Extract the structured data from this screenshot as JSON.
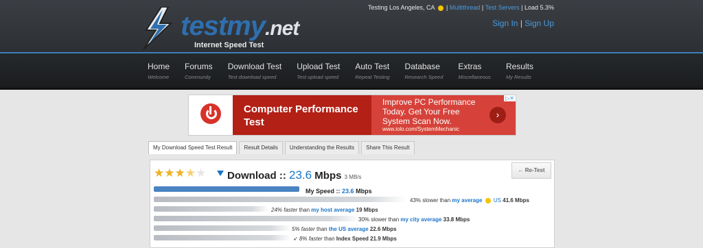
{
  "header": {
    "logo_main": "testmy",
    "logo_net": ".net",
    "logo_sub": "Internet Speed Test",
    "status_prefix": "Testing Los Angeles, CA",
    "status_multithread": "Multithread",
    "status_test_servers": "Test Servers",
    "status_load": "Load 5.3%",
    "sign_in": "Sign In",
    "sign_up": "Sign Up"
  },
  "nav": [
    {
      "title": "Home",
      "sub": "Welcome"
    },
    {
      "title": "Forums",
      "sub": "Community"
    },
    {
      "title": "Download Test",
      "sub": "Test download speed"
    },
    {
      "title": "Upload Test",
      "sub": "Test upload speed"
    },
    {
      "title": "Auto Test",
      "sub": "Repeat Testing"
    },
    {
      "title": "Database",
      "sub": "Research Speed"
    },
    {
      "title": "Extras",
      "sub": "Miscellaneous"
    },
    {
      "title": "Results",
      "sub": "My Results"
    }
  ],
  "ad": {
    "headline": "Computer Performance Test",
    "body": "Improve PC Performance Today. Get Your Free System Scan Now.",
    "url": "www.iolo.com/SystemMechanic",
    "go_label": "›",
    "ad_badge": "▷✕"
  },
  "tabs": [
    {
      "label": "My Download Speed Test Result",
      "active": true
    },
    {
      "label": "Result Details",
      "active": false
    },
    {
      "label": "Understanding the Results",
      "active": false
    },
    {
      "label": "Share This Result",
      "active": false
    }
  ],
  "result": {
    "rating_stars": 3.5,
    "download_label": "Download",
    "separator": "::",
    "speed": "23.6",
    "speed_unit": "Mbps",
    "speed_mbs": "3 MB/s",
    "retest": "← Re-Test",
    "my_speed_label": "My Speed ::",
    "my_speed_value": "23.6",
    "my_speed_unit": "Mbps"
  },
  "comparisons": [
    {
      "prefix": "43% slower than",
      "link": "my average",
      "mid": "US",
      "suffix": "41.6 Mbps",
      "fill": 0.63
    },
    {
      "prefix_italic": "24% faster",
      "prefix": "than",
      "link": "my host average",
      "suffix": "19 Mbps",
      "fill": 0.26
    },
    {
      "prefix": "30% slower than",
      "link": "my city average",
      "suffix": "33.8 Mbps",
      "fill": 0.53
    },
    {
      "prefix_italic": "5% faster",
      "prefix": "than",
      "link": "the US average",
      "suffix": "22.6 Mbps",
      "fill": 0.33
    },
    {
      "prefix_italic": "8% faster",
      "prefix": "than",
      "link": "",
      "suffix": "Index Speed 21.9 Mbps",
      "fill": 0.33
    }
  ],
  "colors": {
    "accent": "#1b74c8",
    "header_bg": "#2c2f33",
    "ad_red": "#b22016"
  }
}
